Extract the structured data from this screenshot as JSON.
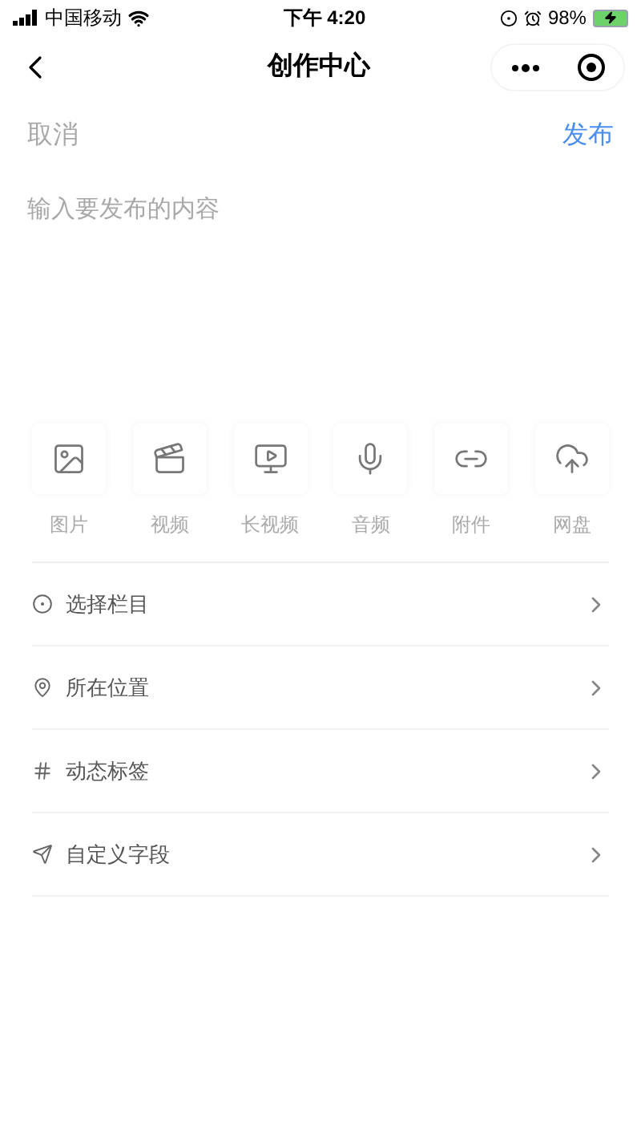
{
  "status_bar": {
    "carrier": "中国移动",
    "time": "下午 4:20",
    "battery": "98%"
  },
  "nav": {
    "title": "创作中心"
  },
  "actions": {
    "cancel": "取消",
    "publish": "发布"
  },
  "editor": {
    "placeholder": "输入要发布的内容"
  },
  "media": [
    {
      "kind": "image",
      "label": "图片"
    },
    {
      "kind": "video",
      "label": "视频"
    },
    {
      "kind": "long-video",
      "label": "长视频"
    },
    {
      "kind": "audio",
      "label": "音频"
    },
    {
      "kind": "attachment",
      "label": "附件"
    },
    {
      "kind": "cloud",
      "label": "网盘"
    }
  ],
  "options": [
    {
      "kind": "column",
      "label": "选择栏目"
    },
    {
      "kind": "location",
      "label": "所在位置"
    },
    {
      "kind": "tag",
      "label": "动态标签"
    },
    {
      "kind": "custom",
      "label": "自定义字段"
    }
  ]
}
